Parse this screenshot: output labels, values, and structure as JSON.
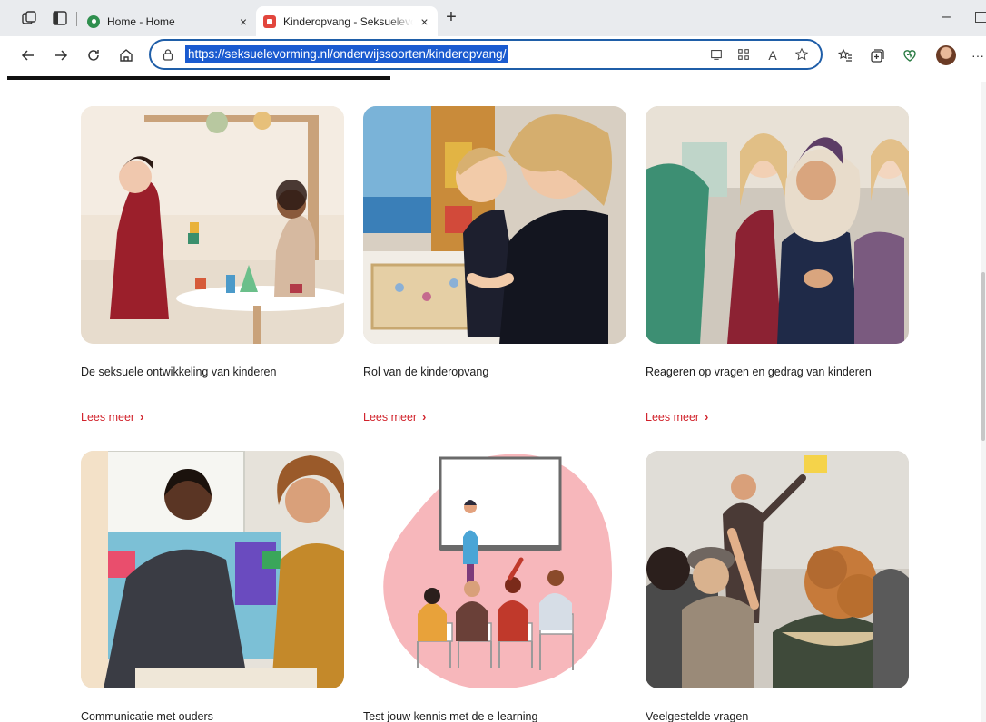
{
  "browser": {
    "tabs": [
      {
        "title": "Home - Home",
        "close": "×"
      },
      {
        "title": "Kinderopvang - Seksuelevorming",
        "close": "×"
      }
    ],
    "new_tab": "+",
    "url": "https://seksuelevorming.nl/onderwijssoorten/kinderopvang/",
    "icons": [
      "workspaces-icon",
      "tab-actions-icon",
      "back-icon",
      "forward-icon",
      "refresh-icon",
      "home-icon",
      "lock-icon",
      "immersive-reader-icon",
      "app-available-icon",
      "read-aloud-icon",
      "favorite-star-icon",
      "favorites-icon",
      "collections-icon",
      "browser-essentials-icon",
      "profile-avatar",
      "more-icon"
    ],
    "glyphs": {
      "read_aloud": "A",
      "more": "···",
      "minimize": "–"
    }
  },
  "cards": [
    {
      "title": "De seksuele ontwikkeling van kinderen",
      "link": "Lees meer"
    },
    {
      "title": "Rol van de kinderopvang",
      "link": "Lees meer"
    },
    {
      "title": "Reageren op vragen en gedrag van kinderen",
      "link": "Lees meer"
    },
    {
      "title": "Communicatie met ouders",
      "link": ""
    },
    {
      "title": "Test jouw kennis met de e-learning",
      "link": ""
    },
    {
      "title": "Veelgestelde vragen",
      "link": ""
    }
  ],
  "link_chevron": "›",
  "colors": {
    "accent_red": "#d1222b",
    "url_highlight": "#1a5bd0",
    "omnibox_border": "#1f5ea8",
    "tabstrip": "#e9ebee"
  }
}
